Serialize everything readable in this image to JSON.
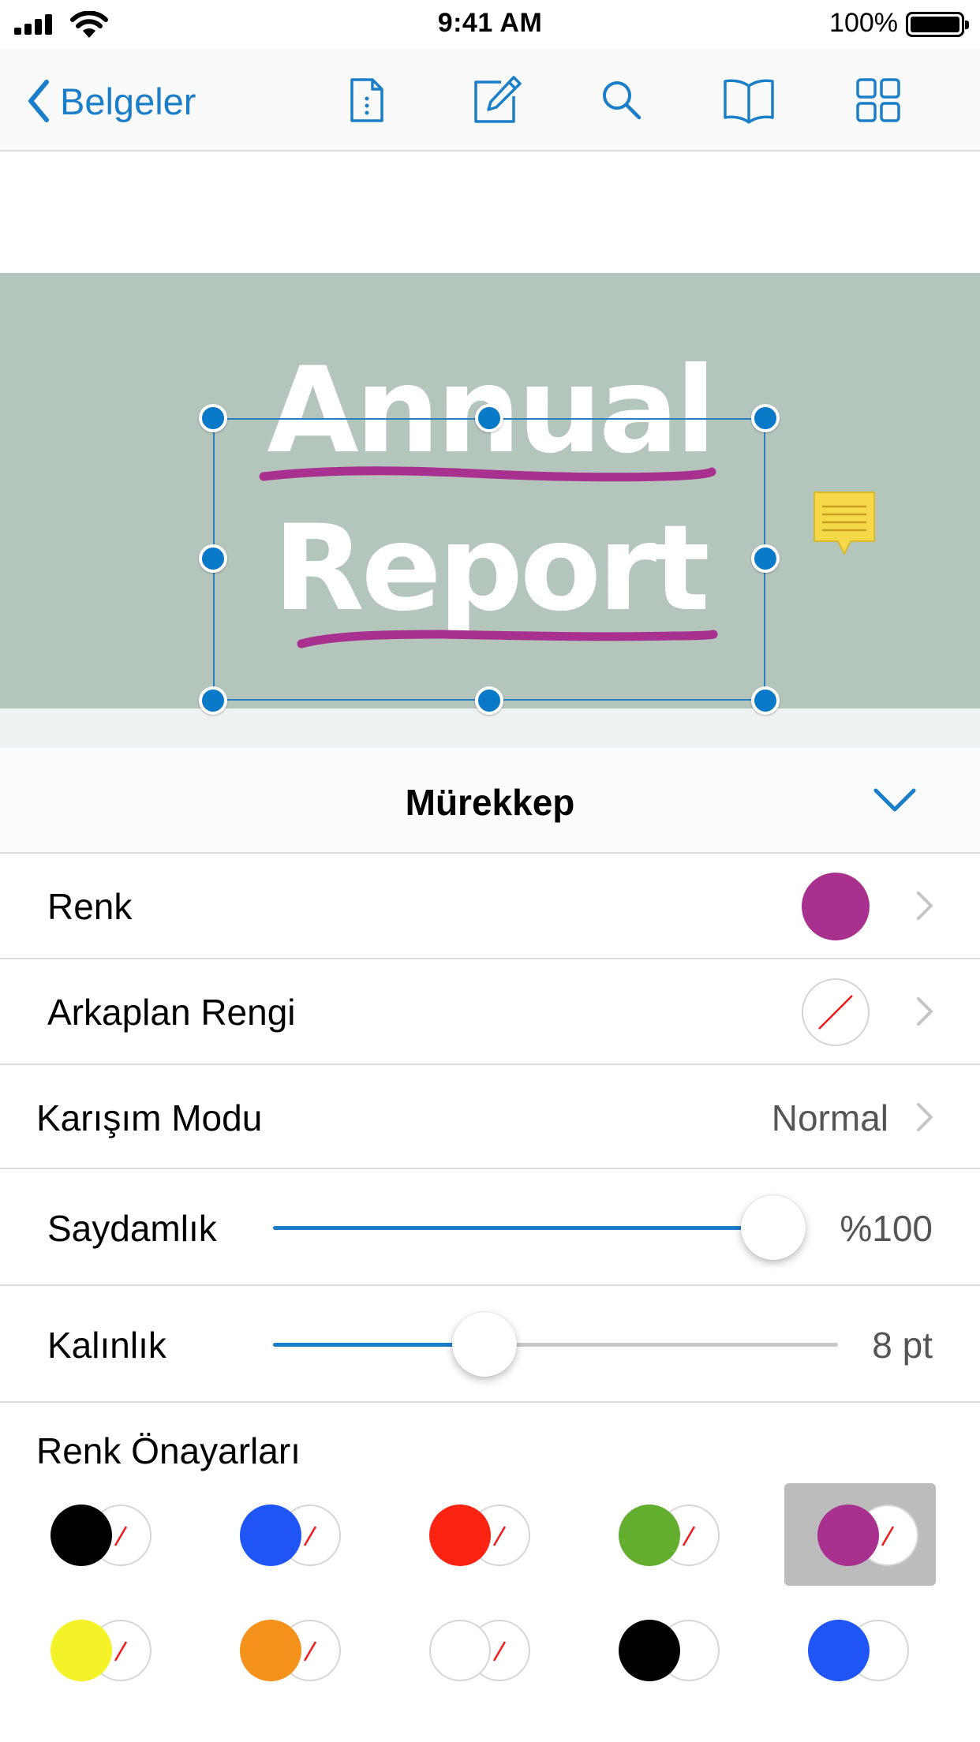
{
  "status_bar": {
    "time": "9:41 AM",
    "battery": "100%"
  },
  "nav": {
    "back_label": "Belgeler",
    "icons": [
      "document-info-icon",
      "edit-annotation-icon",
      "search-icon",
      "reader-view-icon",
      "thumbnails-grid-icon"
    ],
    "accent_color": "#1a7ec8"
  },
  "document": {
    "title_line1": "Annual",
    "title_line2": "Report",
    "banner_color": "#b4c5bc",
    "ink_color": "#a8308f"
  },
  "inspector": {
    "title": "Mürekkep",
    "rows": {
      "color": {
        "label": "Renk",
        "value_color": "#a8308f"
      },
      "background": {
        "label": "Arkaplan Rengi",
        "value_color": "none"
      },
      "blend": {
        "label": "Karışım Modu",
        "value": "Normal"
      },
      "opacity": {
        "label": "Saydamlık",
        "value": "%100",
        "fraction": 1.0
      },
      "thickness": {
        "label": "Kalınlık",
        "value": "8 pt",
        "fraction": 0.45
      }
    },
    "presets_title": "Renk Önayarları",
    "presets": [
      {
        "color": "#000000",
        "background": "none"
      },
      {
        "color": "#1f55f5",
        "background": "none"
      },
      {
        "color": "#fb2412",
        "background": "none"
      },
      {
        "color": "#63ad2f",
        "background": "none"
      },
      {
        "color": "#a8308f",
        "background": "none",
        "selected": true
      },
      {
        "color": "#f4f32a",
        "background": "none"
      },
      {
        "color": "#f5921c",
        "background": "none"
      },
      {
        "color": "#ffffff",
        "background": "none"
      },
      {
        "color": "#000000",
        "background": "#ffffff"
      },
      {
        "color": "#1f55f5",
        "background": "#ffffff"
      }
    ]
  }
}
